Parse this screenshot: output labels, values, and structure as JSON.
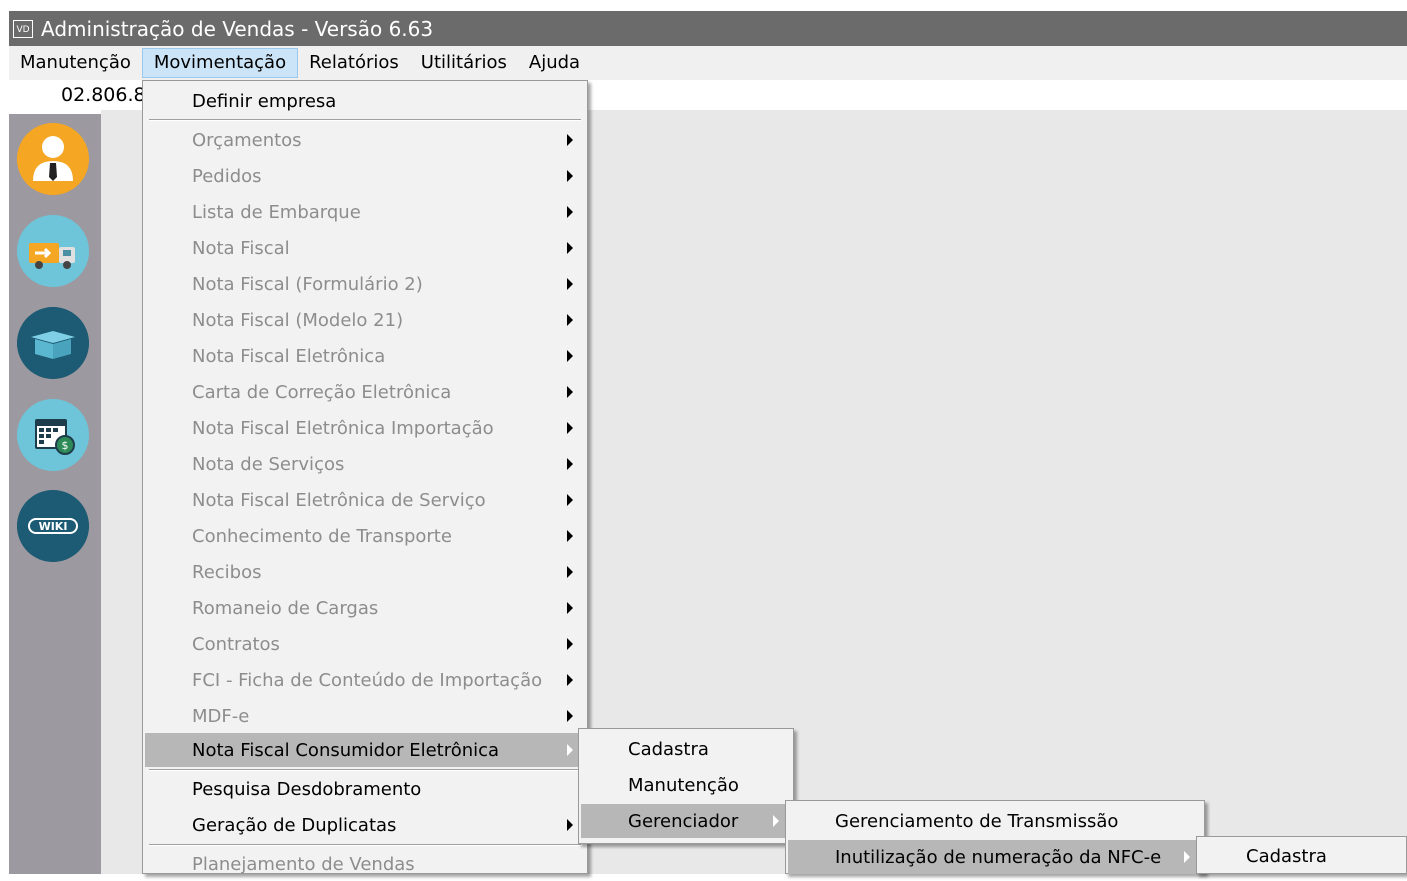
{
  "window": {
    "app_icon": "VD",
    "title": "Administração de Vendas - Versão 6.63"
  },
  "menubar": [
    "Manutenção",
    "Movimentação",
    "Relatórios",
    "Utilitários",
    "Ajuda"
  ],
  "infobar": {
    "cnpj": "02.806.8"
  },
  "sidebar": [
    {
      "icon": "user-icon"
    },
    {
      "icon": "delivery-truck-icon"
    },
    {
      "icon": "package-box-icon"
    },
    {
      "icon": "calendar-money-icon"
    },
    {
      "icon": "wiki-icon",
      "label": "WIKI"
    }
  ],
  "movimentacao_menu": {
    "items": [
      "Definir empresa",
      "Orçamentos",
      "Pedidos",
      "Lista de Embarque",
      "Nota Fiscal",
      "Nota Fiscal (Formulário 2)",
      "Nota Fiscal (Modelo 21)",
      "Nota Fiscal Eletrônica",
      "Carta de Correção Eletrônica",
      "Nota Fiscal Eletrônica Importação",
      "Nota de Serviços",
      "Nota Fiscal Eletrônica de Serviço",
      "Conhecimento de Transporte",
      "Recibos",
      "Romaneio de Cargas",
      "Contratos",
      "FCI - Ficha de Conteúdo de Importação",
      "MDF-e",
      "Nota Fiscal Consumidor Eletrônica",
      "Pesquisa Desdobramento",
      "Geração de Duplicatas",
      "Planejamento de Vendas"
    ]
  },
  "nfce_menu": {
    "items": [
      "Cadastra",
      "Manutenção",
      "Gerenciador"
    ]
  },
  "gerenciador_menu": {
    "items": [
      "Gerenciamento de Transmissão",
      "Inutilização de numeração da NFC-e"
    ]
  },
  "inutilizacao_menu": {
    "items": [
      "Cadastra"
    ]
  }
}
